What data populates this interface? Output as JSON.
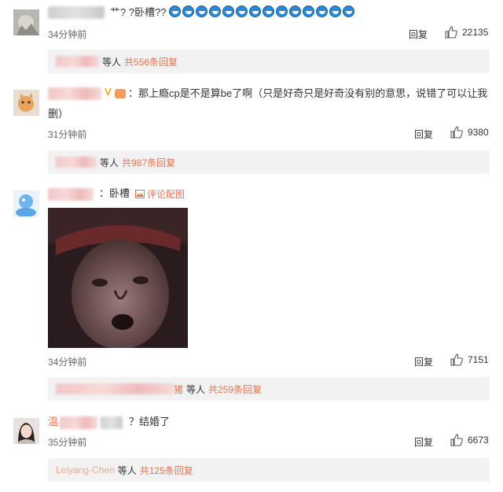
{
  "comments": [
    {
      "username": "…SOU",
      "text_prefix": "艹? ?卧槽??",
      "emoji_count": 14,
      "time": "34分钟前",
      "reply_label": "回复",
      "likes": "22135",
      "sub_prefix": "等人",
      "sub_count": "共556条回复"
    },
    {
      "text_line1": "：那上瘾cp是不是算be了啊（只是好奇只是好奇没有别的意思，说错了可以让我",
      "text_line2": "删）",
      "time": "31分钟前",
      "reply_label": "回复",
      "likes": "9380",
      "sub_prefix": "等人",
      "sub_count": "共987条回复"
    },
    {
      "text": "：卧槽",
      "image_link": "评论配图",
      "time": "34分钟前",
      "reply_label": "回复",
      "likes": "7151",
      "sub_suffix_name": "猪",
      "sub_prefix": "等人",
      "sub_count": "共259条回复"
    },
    {
      "username": "温",
      "text": "？结婚了",
      "time": "35分钟前",
      "reply_label": "回复",
      "likes": "6673",
      "sub_name": "Leiyang-Chen",
      "sub_prefix": "等人",
      "sub_count": "共125条回复"
    }
  ],
  "colors": {
    "accent": "#eb7350",
    "sub_bg": "#f2f2f2",
    "time": "#666666"
  },
  "icons": {
    "like": "thumb-up-icon",
    "image": "image-icon"
  }
}
